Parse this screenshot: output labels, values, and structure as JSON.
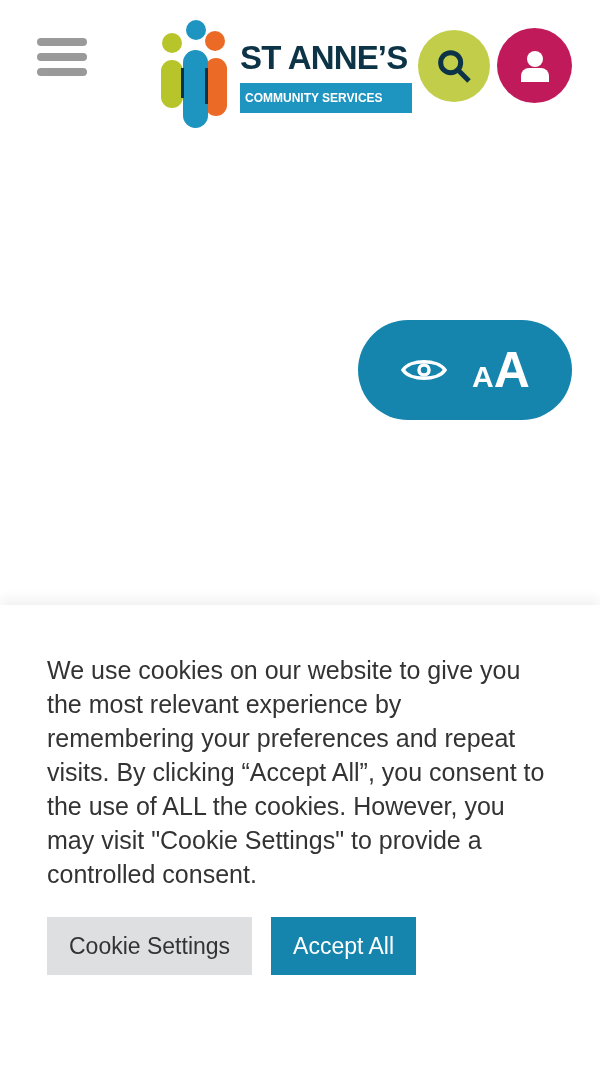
{
  "header": {
    "logo": {
      "title": "ST ANNE’S",
      "subtitle": "COMMUNITY SERVICES"
    }
  },
  "accessibility_button": {
    "small_letter": "A",
    "large_letter": "A"
  },
  "cookie_banner": {
    "message": "We use cookies on our website to give you the most relevant experience by remembering your preferences and repeat visits. By clicking “Accept All”, you consent to the use of ALL the cookies. However, you may visit \"Cookie Settings\" to provide a controlled consent.",
    "buttons": [
      {
        "label": "Cookie Settings",
        "kind": "secondary"
      },
      {
        "label": "Accept All",
        "kind": "primary"
      }
    ]
  }
}
